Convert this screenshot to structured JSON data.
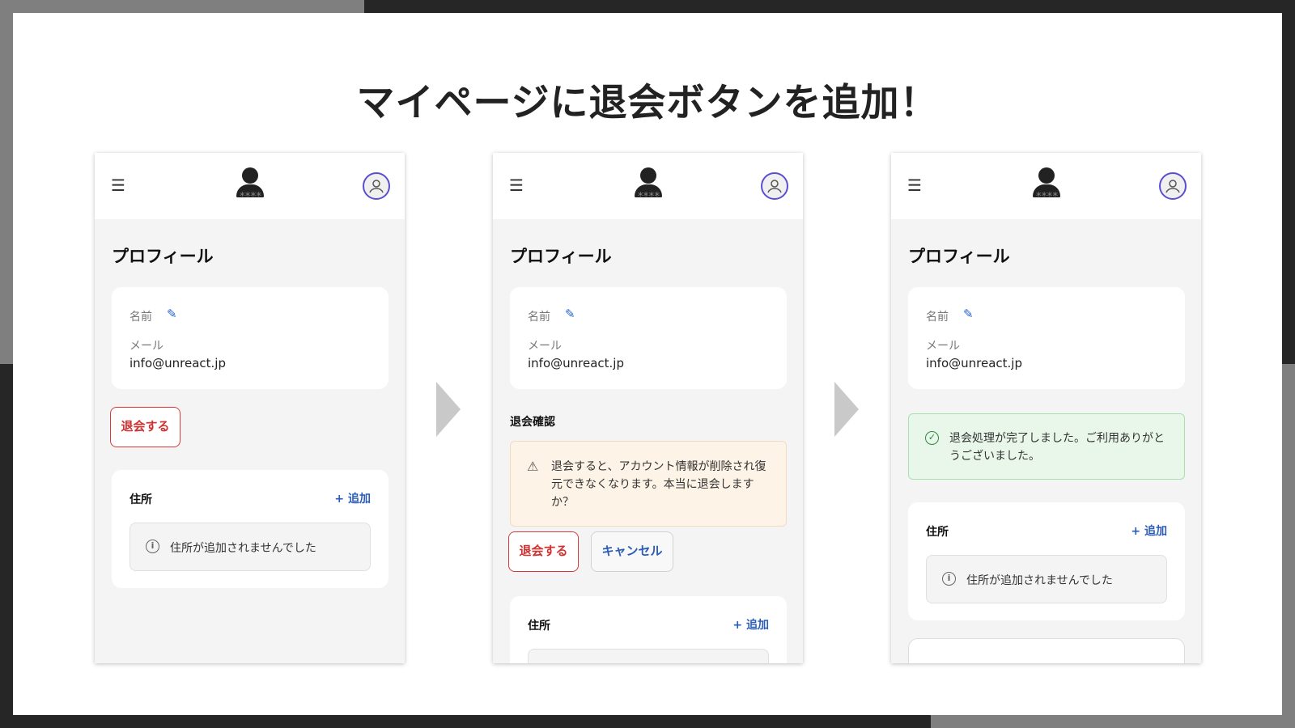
{
  "slide": {
    "title": "マイページに退会ボタンを追加！"
  },
  "app": {
    "menu_icon": "☰",
    "logo_stars": "****",
    "page_title": "プロフィール",
    "name_label": "名前",
    "mail_label": "メール",
    "mail_value": "info@unreact.jp",
    "address_label": "住所",
    "add_link": "+ 追加",
    "empty_address": "住所が追加されませんでした"
  },
  "screen1": {
    "withdraw_button": "退会する"
  },
  "screen2": {
    "confirm_heading": "退会確認",
    "warning_text": "退会すると、アカウント情報が削除され復元できなくなります。本当に退会しますか？",
    "withdraw_button": "退会する",
    "cancel_button": "キャンセル"
  },
  "screen3": {
    "success_text": "退会処理が完了しました。ご利用ありがとうございました。"
  },
  "colors": {
    "danger": "#d03030",
    "link": "#2a5bb8",
    "warning_bg": "#fdf3e6",
    "success_bg": "#e8f7e9",
    "avatar_ring": "#5b4fd1"
  }
}
